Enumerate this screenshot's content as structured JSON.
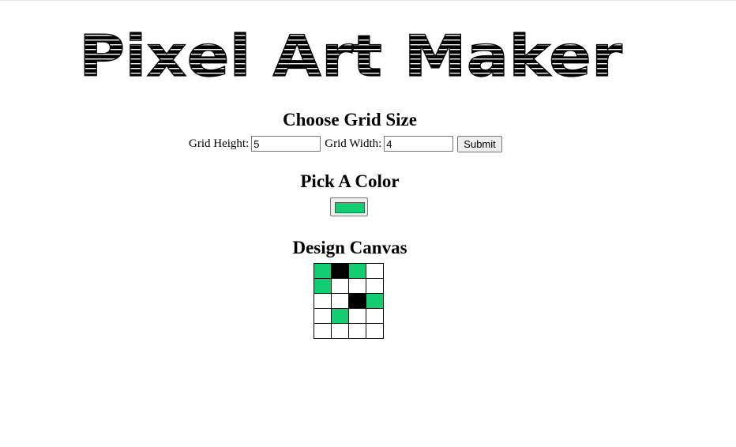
{
  "logo": {
    "text": "Pixel Art Maker"
  },
  "grid_size": {
    "heading": "Choose Grid Size",
    "height_label": "Grid Height:",
    "height_value": "5",
    "width_label": "Grid Width:",
    "width_value": "4",
    "submit_label": "Submit"
  },
  "color": {
    "heading": "Pick A Color",
    "value": "#14cc72"
  },
  "canvas": {
    "heading": "Design Canvas",
    "rows": [
      [
        "#14cc72",
        "#000000",
        "#14cc72",
        "#ffffff"
      ],
      [
        "#14cc72",
        "#ffffff",
        "#ffffff",
        "#ffffff"
      ],
      [
        "#ffffff",
        "#ffffff",
        "#000000",
        "#14cc72"
      ],
      [
        "#ffffff",
        "#14cc72",
        "#ffffff",
        "#ffffff"
      ],
      [
        "#ffffff",
        "#ffffff",
        "#ffffff",
        "#ffffff"
      ]
    ]
  }
}
